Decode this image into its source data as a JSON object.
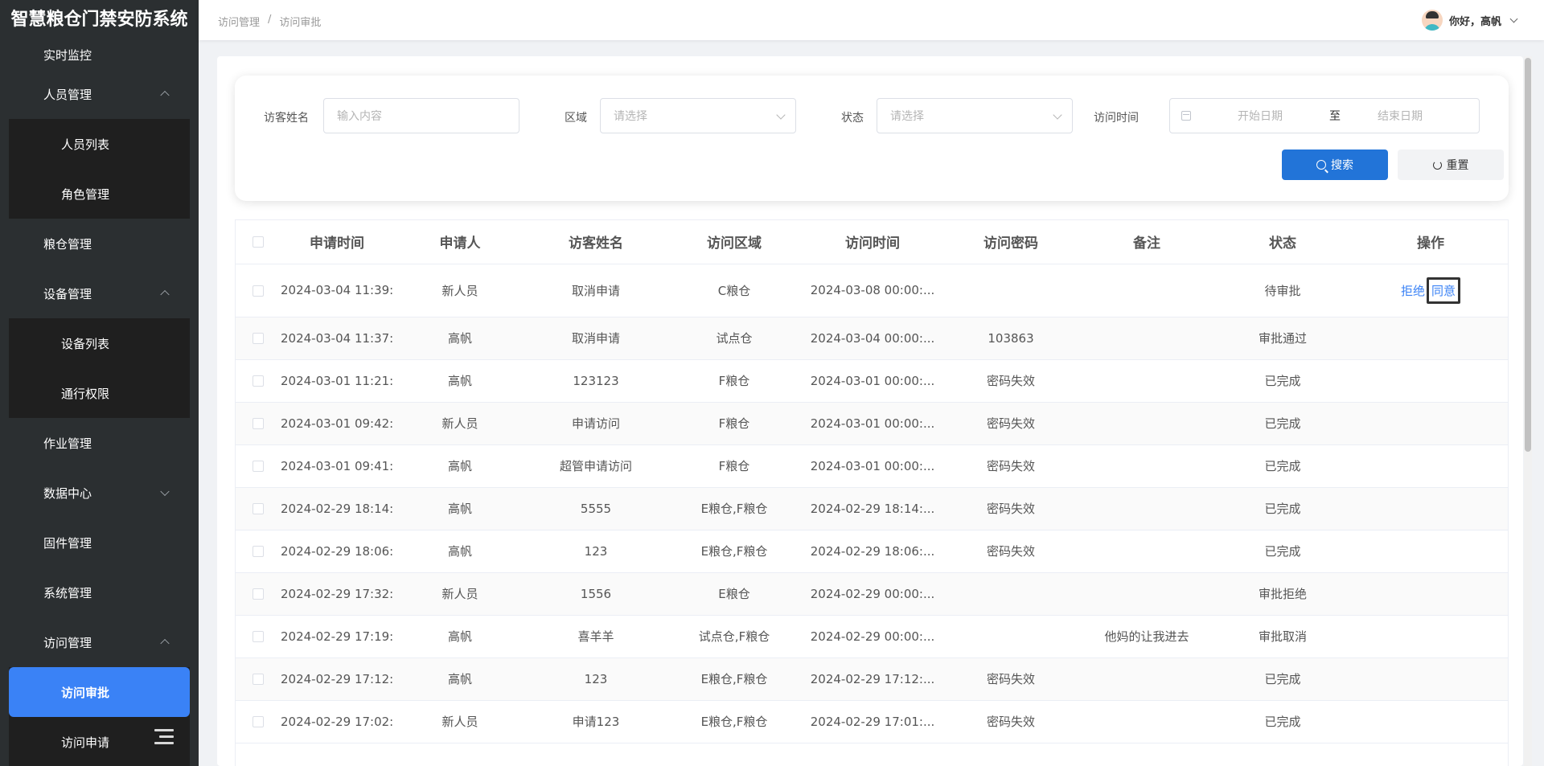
{
  "app": {
    "title": "智慧粮仓门禁安防系统"
  },
  "sidebar": {
    "items": [
      {
        "label": "实时监控"
      },
      {
        "label": "人员管理",
        "children": [
          {
            "label": "人员列表"
          },
          {
            "label": "角色管理"
          }
        ]
      },
      {
        "label": "粮仓管理"
      },
      {
        "label": "设备管理",
        "children": [
          {
            "label": "设备列表"
          },
          {
            "label": "通行权限"
          }
        ]
      },
      {
        "label": "作业管理"
      },
      {
        "label": "数据中心"
      },
      {
        "label": "固件管理"
      },
      {
        "label": "系统管理"
      },
      {
        "label": "访问管理",
        "children": [
          {
            "label": "访问审批"
          },
          {
            "label": "访问申请"
          }
        ]
      }
    ]
  },
  "header": {
    "breadcrumb": [
      "访问管理",
      "访问审批"
    ],
    "breadcrumb_sep": "/",
    "greeting": "你好，高帆"
  },
  "filters": {
    "visitor_name": {
      "label": "访客姓名",
      "placeholder": "输入内容"
    },
    "area": {
      "label": "区域",
      "placeholder": "请选择"
    },
    "status": {
      "label": "状态",
      "placeholder": "请选择"
    },
    "visit_time": {
      "label": "访问时间",
      "start_placeholder": "开始日期",
      "separator": "至",
      "end_placeholder": "结束日期"
    },
    "search_label": "搜索",
    "reset_label": "重置"
  },
  "table": {
    "columns": [
      "申请时间",
      "申请人",
      "访客姓名",
      "访问区域",
      "访问时间",
      "访问密码",
      "备注",
      "状态",
      "操作"
    ],
    "rows": [
      {
        "apply_time": "2024-03-04 11:39:...",
        "applicant": "新人员",
        "visitor": "取消申请",
        "area": "C粮仓",
        "visit_time": "2024-03-08 00:00:...",
        "password": "",
        "remark": "",
        "status": "待审批",
        "actions": [
          "拒绝",
          "同意"
        ]
      },
      {
        "apply_time": "2024-03-04 11:37:...",
        "applicant": "高帆",
        "visitor": "取消申请",
        "area": "试点仓",
        "visit_time": "2024-03-04 00:00:...",
        "password": "103863",
        "remark": "",
        "status": "审批通过"
      },
      {
        "apply_time": "2024-03-01 11:21:...",
        "applicant": "高帆",
        "visitor": "123123",
        "area": "F粮仓",
        "visit_time": "2024-03-01 00:00:...",
        "password": "密码失效",
        "remark": "",
        "status": "已完成"
      },
      {
        "apply_time": "2024-03-01 09:42:...",
        "applicant": "新人员",
        "visitor": "申请访问",
        "area": "F粮仓",
        "visit_time": "2024-03-01 00:00:...",
        "password": "密码失效",
        "remark": "",
        "status": "已完成"
      },
      {
        "apply_time": "2024-03-01 09:41:...",
        "applicant": "高帆",
        "visitor": "超管申请访问",
        "area": "F粮仓",
        "visit_time": "2024-03-01 00:00:...",
        "password": "密码失效",
        "remark": "",
        "status": "已完成"
      },
      {
        "apply_time": "2024-02-29 18:14:...",
        "applicant": "高帆",
        "visitor": "5555",
        "area": "E粮仓,F粮仓",
        "visit_time": "2024-02-29 18:14:...",
        "password": "密码失效",
        "remark": "",
        "status": "已完成"
      },
      {
        "apply_time": "2024-02-29 18:06:...",
        "applicant": "高帆",
        "visitor": "123",
        "area": "E粮仓,F粮仓",
        "visit_time": "2024-02-29 18:06:...",
        "password": "密码失效",
        "remark": "",
        "status": "已完成"
      },
      {
        "apply_time": "2024-02-29 17:32:...",
        "applicant": "新人员",
        "visitor": "1556",
        "area": "E粮仓",
        "visit_time": "2024-02-29 00:00:...",
        "password": "",
        "remark": "",
        "status": "审批拒绝"
      },
      {
        "apply_time": "2024-02-29 17:19:...",
        "applicant": "高帆",
        "visitor": "喜羊羊",
        "area": "试点仓,F粮仓",
        "visit_time": "2024-02-29 00:00:...",
        "password": "",
        "remark": "他妈的让我进去",
        "status": "审批取消"
      },
      {
        "apply_time": "2024-02-29 17:12:...",
        "applicant": "高帆",
        "visitor": "123",
        "area": "E粮仓,F粮仓",
        "visit_time": "2024-02-29 17:12:...",
        "password": "密码失效",
        "remark": "",
        "status": "已完成"
      },
      {
        "apply_time": "2024-02-29 17:02:...",
        "applicant": "新人员",
        "visitor": "申请123",
        "area": "E粮仓,F粮仓",
        "visit_time": "2024-02-29 17:01:...",
        "password": "密码失效",
        "remark": "",
        "status": "已完成"
      }
    ]
  }
}
